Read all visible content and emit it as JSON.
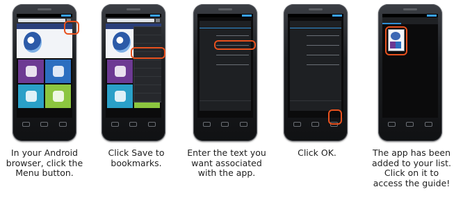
{
  "steps": [
    {
      "caption": "In your Android browser, click the Menu button."
    },
    {
      "caption": "Click Save to bookmarks."
    },
    {
      "caption": "Enter the text you want associated with the app."
    },
    {
      "caption": "Click OK."
    },
    {
      "caption": "The app has been added to your list. Click on it to access the guide!"
    }
  ],
  "colors": {
    "highlight": "#e8511e",
    "accent": "#2f90d8"
  }
}
